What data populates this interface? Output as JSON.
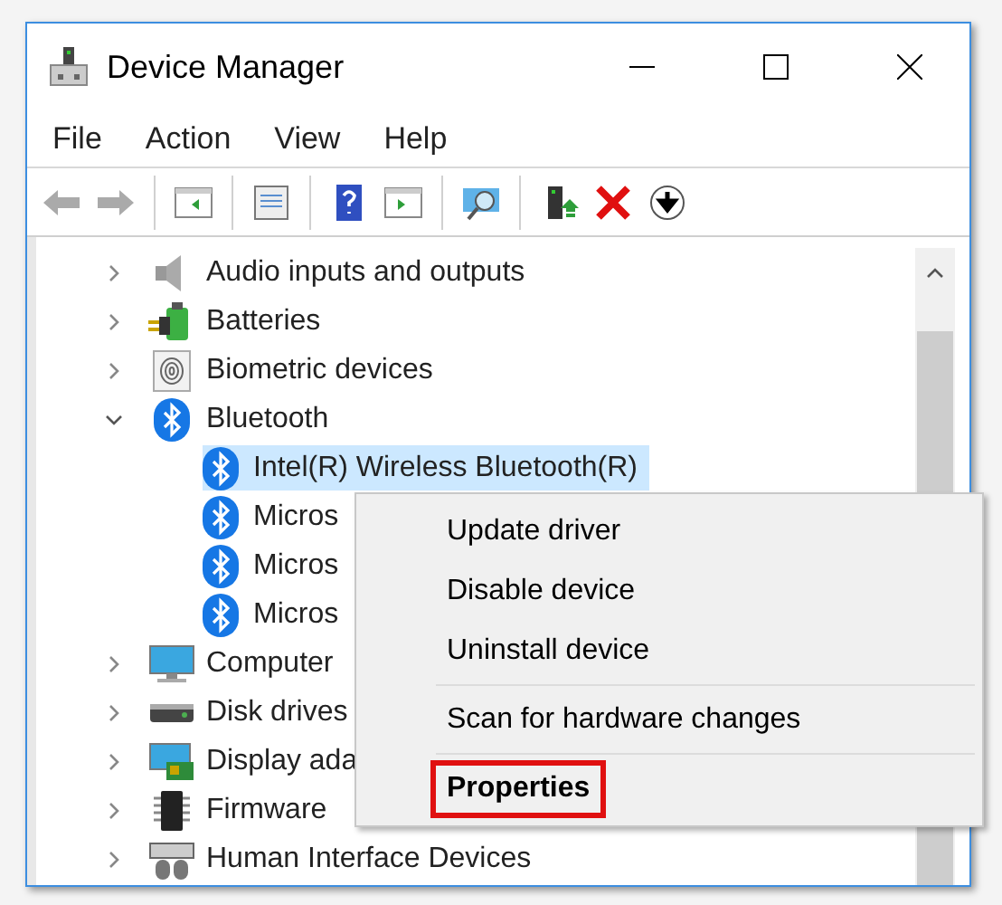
{
  "window": {
    "title": "Device Manager"
  },
  "menu_bar": [
    "File",
    "Action",
    "View",
    "Help"
  ],
  "tree": [
    {
      "label": "Audio inputs and outputs",
      "expanded": false
    },
    {
      "label": "Batteries",
      "expanded": false
    },
    {
      "label": "Biometric devices",
      "expanded": false
    },
    {
      "label": "Bluetooth",
      "expanded": true,
      "children": [
        {
          "label": "Intel(R) Wireless Bluetooth(R)",
          "selected": true
        },
        {
          "label": "Micros",
          "selected": false
        },
        {
          "label": "Micros",
          "selected": false
        },
        {
          "label": "Micros",
          "selected": false
        }
      ]
    },
    {
      "label": "Computer",
      "expanded": false
    },
    {
      "label": "Disk drives",
      "expanded": false
    },
    {
      "label": "Display ada",
      "expanded": false
    },
    {
      "label": "Firmware",
      "expanded": false
    },
    {
      "label": "Human Interface Devices",
      "expanded": false
    }
  ],
  "context_menu": [
    {
      "kind": "item",
      "label": "Update driver",
      "bold": false,
      "highlighted": false
    },
    {
      "kind": "item",
      "label": "Disable device",
      "bold": false,
      "highlighted": false
    },
    {
      "kind": "item",
      "label": "Uninstall device",
      "bold": false,
      "highlighted": false
    },
    {
      "kind": "separator"
    },
    {
      "kind": "item",
      "label": "Scan for hardware changes",
      "bold": false,
      "highlighted": false
    },
    {
      "kind": "separator"
    },
    {
      "kind": "item",
      "label": "Properties",
      "bold": true,
      "highlighted": true
    }
  ]
}
